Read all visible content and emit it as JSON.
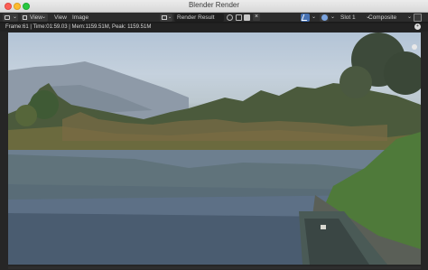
{
  "window": {
    "title": "Blender Render"
  },
  "header": {
    "view_dropdown": "View",
    "menu_view": "View",
    "menu_image": "Image",
    "image_name": "Render Result",
    "slot": "Slot 1",
    "pass": "Composite",
    "close_glyph": "×",
    "chevron": "⌄"
  },
  "status": {
    "text": "Frame:61 | Time:01:59.03 | Mem:1159.51M, Peak: 1159.51M",
    "toggle_glyph": "+"
  },
  "colors": {
    "accent": "#4772b3",
    "header_bg": "#2b2b2b",
    "editor_bg": "#1d1d1d"
  },
  "icons": {
    "editor_type": "image-editor-icon",
    "view_mode": "view-icon",
    "image_browse": "image-browse-icon",
    "fake_user": "shield-icon",
    "duplicate": "copy-icon",
    "open": "folder-icon",
    "unlink": "close-icon",
    "sample_tool": "sample-tool-icon",
    "display_mode": "display-icon",
    "sidebar_toggle": "sidebar-icon"
  }
}
